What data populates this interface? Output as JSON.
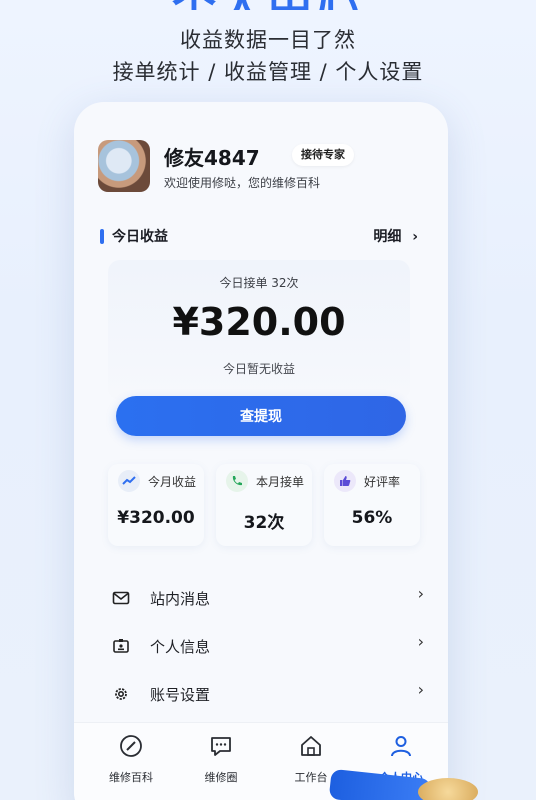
{
  "hero": {
    "title": "个人中心",
    "subtitle1": "收益数据一目了然",
    "subtitle2": "接单统计 / 收益管理 / 个人设置"
  },
  "profile": {
    "username": "修友4847",
    "badge": "接待专家",
    "welcome": "欢迎使用修哒，您的维修百科"
  },
  "earnings": {
    "section_title": "今日收益",
    "detail_label": "明细",
    "orders_today": "今日接单 32次",
    "amount": "¥320.00",
    "status": "今日暂无收益",
    "withdraw_label": "查提现"
  },
  "stats": [
    {
      "icon": "trend-icon",
      "label": "今月收益",
      "value": "¥320.00",
      "color": "#e8eef8"
    },
    {
      "icon": "phone-icon",
      "label": "本月接单",
      "value": "32次",
      "color": "#e6f4ea"
    },
    {
      "icon": "thumbs-up-icon",
      "label": "好评率",
      "value": "56%",
      "color": "#ece8fa"
    }
  ],
  "menu": [
    {
      "icon": "mail-icon",
      "label": "站内消息"
    },
    {
      "icon": "id-card-icon",
      "label": "个人信息"
    },
    {
      "icon": "gear-icon",
      "label": "账号设置"
    }
  ],
  "tabs": [
    {
      "icon": "compass-icon",
      "label": "维修百科"
    },
    {
      "icon": "chat-icon",
      "label": "维修圈"
    },
    {
      "icon": "home-icon",
      "label": "工作台"
    },
    {
      "icon": "user-icon",
      "label": "个人中心",
      "active": true
    }
  ],
  "colors": {
    "accent": "#2f6ff0",
    "active_tab": "#1e5fe0"
  }
}
